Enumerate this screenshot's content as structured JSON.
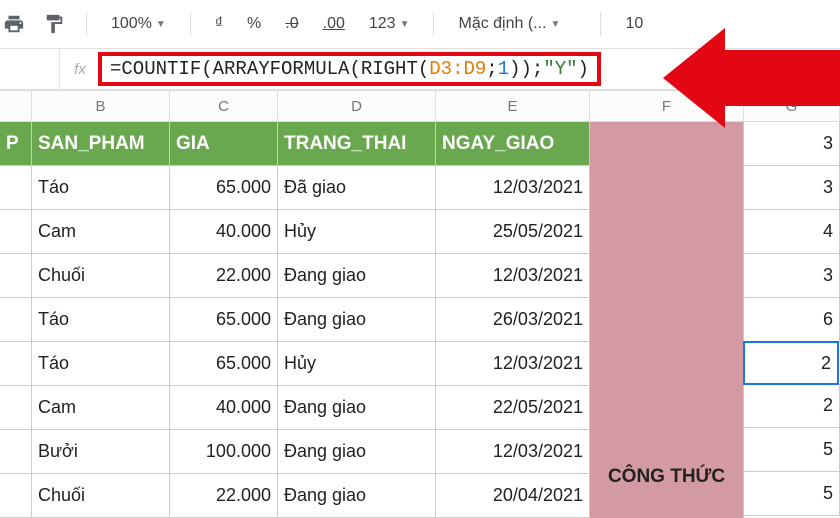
{
  "toolbar": {
    "zoom": "100%",
    "currency": "₫",
    "percent": "%",
    "dec_dec": ".0",
    "dec_inc": ".00",
    "numfmt": "123",
    "font": "Mặc định (...",
    "fontsize": "10"
  },
  "formula_bar": {
    "fx_label": "fx",
    "formula_parts": {
      "p1": "=COUNTIF(ARRAYFORMULA(RIGHT(",
      "range": "D3:D9",
      "p2": ";",
      "num": "1",
      "p3": "));",
      "str": "\"Y\"",
      "p4": ")"
    }
  },
  "columns": [
    "B",
    "C",
    "D",
    "E",
    "F",
    "G"
  ],
  "header": {
    "a": "P",
    "b": "SAN_PHAM",
    "c": "GIA",
    "d": "TRANG_THAI",
    "e": "NGAY_GIAO"
  },
  "merged_f_label": "CÔNG THỨC",
  "rows": [
    {
      "b": "Táo",
      "c": "65.000",
      "d": "Đã giao",
      "e": "12/03/2021",
      "g": "3"
    },
    {
      "b": "Cam",
      "c": "40.000",
      "d": "Hủy",
      "e": "25/05/2021",
      "g": "4"
    },
    {
      "b": "Chuối",
      "c": "22.000",
      "d": "Đang giao",
      "e": "12/03/2021",
      "g": "3"
    },
    {
      "b": "Táo",
      "c": "65.000",
      "d": "Đang giao",
      "e": "26/03/2021",
      "g": "6"
    },
    {
      "b": "Táo",
      "c": "65.000",
      "d": "Hủy",
      "e": "12/03/2021",
      "g": "2"
    },
    {
      "b": "Cam",
      "c": "40.000",
      "d": "Đang giao",
      "e": "22/05/2021",
      "g": "2"
    },
    {
      "b": "Bưởi",
      "c": "100.000",
      "d": "Đang giao",
      "e": "12/03/2021",
      "g": "5"
    },
    {
      "b": "Chuối",
      "c": "22.000",
      "d": "Đang giao",
      "e": "20/04/2021",
      "g": "5"
    }
  ],
  "g_header": "3",
  "selected_row_index": 4
}
